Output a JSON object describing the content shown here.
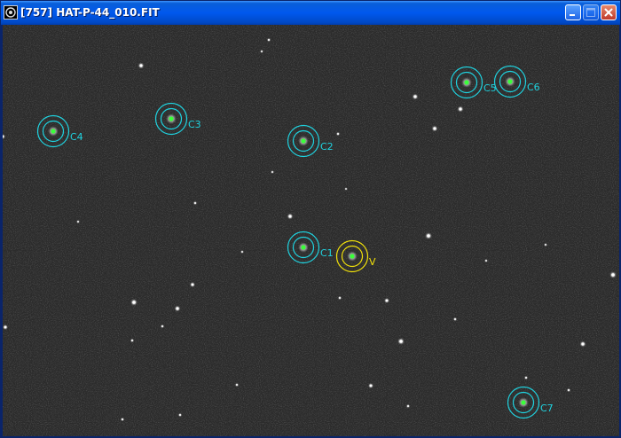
{
  "window": {
    "title": "[757] HAT-P-44_010.FIT",
    "icon": "app-logo-icon",
    "buttons": [
      "minimize-icon",
      "maximize-icon",
      "close-icon"
    ]
  },
  "image": {
    "background_color": "#2b2b2b",
    "comparison_color": "#1fd3e0",
    "variable_color": "#f2e20a",
    "apertures": [
      {
        "id": "c1",
        "label": "C1",
        "kind": "comparison"
      },
      {
        "id": "c2",
        "label": "C2",
        "kind": "comparison"
      },
      {
        "id": "c3",
        "label": "C3",
        "kind": "comparison"
      },
      {
        "id": "c4",
        "label": "C4",
        "kind": "comparison"
      },
      {
        "id": "c5",
        "label": "C5",
        "kind": "comparison"
      },
      {
        "id": "c6",
        "label": "C6",
        "kind": "comparison"
      },
      {
        "id": "c7",
        "label": "C7",
        "kind": "comparison"
      },
      {
        "id": "v",
        "label": "V",
        "kind": "variable"
      }
    ]
  }
}
